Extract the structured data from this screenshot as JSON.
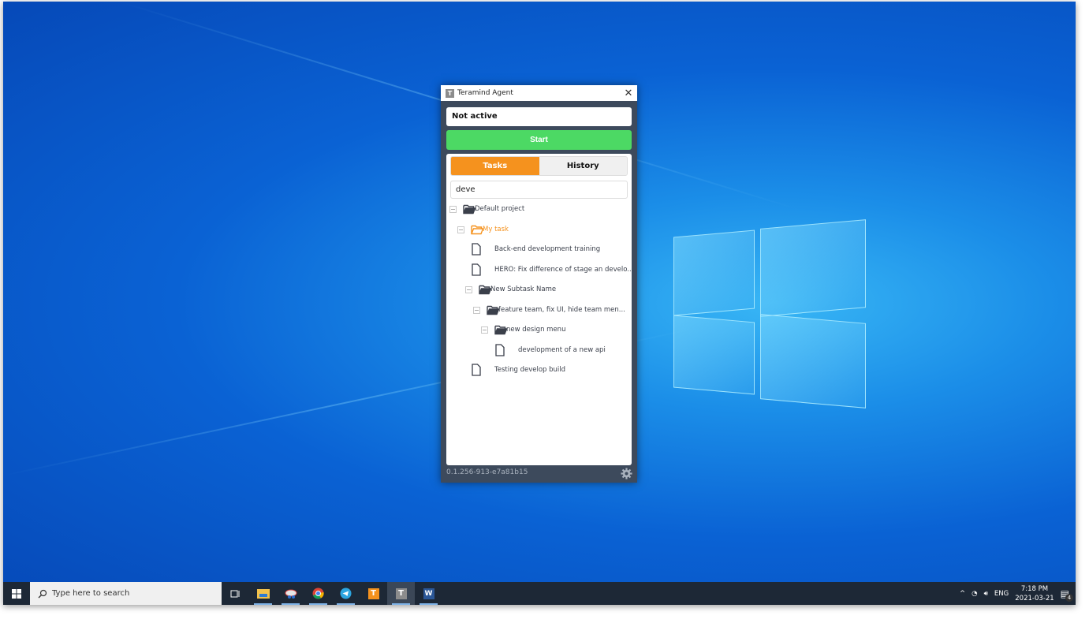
{
  "window": {
    "title": "Teramind Agent",
    "app_icon_letter": "T"
  },
  "status": "Not active",
  "start_label": "Start",
  "tabs": [
    {
      "label": "Tasks",
      "active": true
    },
    {
      "label": "History",
      "active": false
    }
  ],
  "search": {
    "value": "deve"
  },
  "tree": [
    {
      "label": "Default project",
      "type": "folder",
      "level": 0,
      "expanded": true
    },
    {
      "label": "My task",
      "type": "folder",
      "level": 1,
      "expanded": true,
      "selected": true
    },
    {
      "label": "Back-end development training",
      "type": "file",
      "level": 2
    },
    {
      "label": "HERO: Fix difference of stage an develo...",
      "type": "file",
      "level": 2
    },
    {
      "label": "New Subtask Name",
      "type": "folder",
      "level": 2,
      "expanded": true
    },
    {
      "label": "feature team, fix UI,  hide team men...",
      "type": "folder",
      "level": 3,
      "expanded": true
    },
    {
      "label": "new design menu",
      "type": "folder",
      "level": 4,
      "expanded": true
    },
    {
      "label": "development of a new api",
      "type": "file",
      "level": 5
    },
    {
      "label": "Testing develop build",
      "type": "file",
      "level": 2
    }
  ],
  "version": "0.1.256-913-e7a81b15",
  "taskbar": {
    "search_placeholder": "Type here to search",
    "apps": [
      "task-view",
      "file-explorer",
      "snipping-tool",
      "chrome",
      "telegram",
      "teramind-orange",
      "teramind-agent",
      "word"
    ],
    "tray": {
      "language": "ENG",
      "time": "7:18 PM",
      "date": "2021-03-21",
      "notifications": "4"
    }
  },
  "colors": {
    "accent": "#f5921e",
    "start": "#4cd964",
    "window_bg": "#3d4a5c"
  }
}
